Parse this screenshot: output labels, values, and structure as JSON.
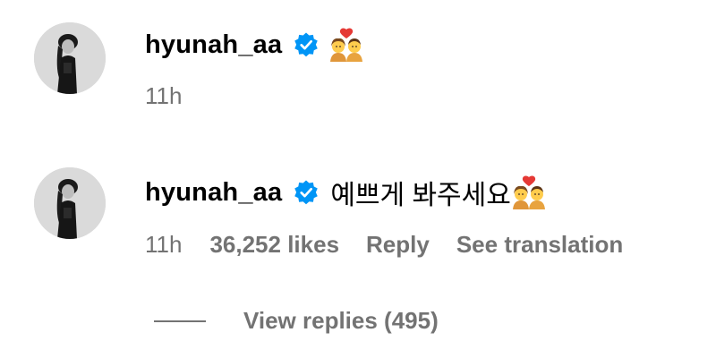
{
  "comments": [
    {
      "username": "hyunah_aa",
      "text": "",
      "emoji_icon": "couple-with-heart-icon",
      "time": "11h",
      "likes": "",
      "reply_label": "",
      "translate_label": ""
    },
    {
      "username": "hyunah_aa",
      "text": "예쁘게 봐주세요",
      "emoji_icon": "couple-with-heart-icon",
      "time": "11h",
      "likes": "36,252 likes",
      "reply_label": "Reply",
      "translate_label": "See translation"
    }
  ],
  "view_replies": {
    "label": "View replies (495)"
  },
  "colors": {
    "verified_badge": "#0095f6",
    "meta_text": "#737373",
    "username_text": "#000000"
  }
}
